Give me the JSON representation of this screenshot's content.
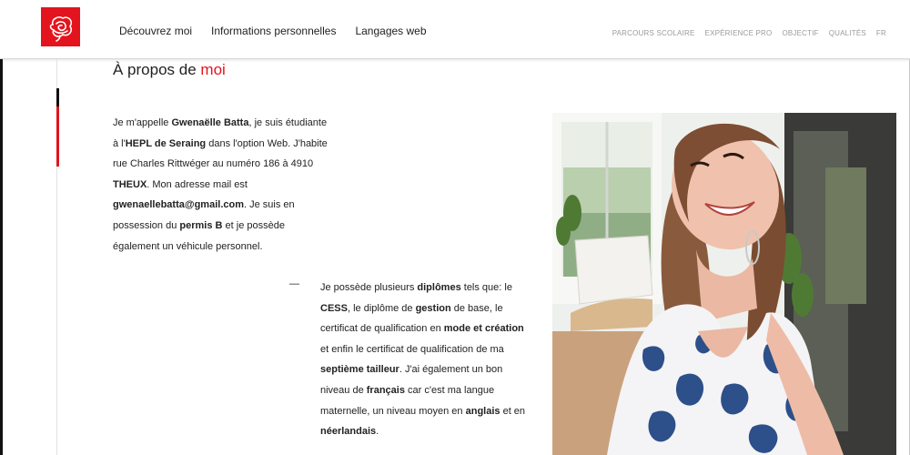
{
  "header": {
    "logo_alt": "Logo",
    "main_nav": [
      "Découvrez moi",
      "Informations personnelles",
      "Langages web"
    ],
    "sub_nav": [
      "PARCOURS SCOLAIRE",
      "EXPÉRIENCE PRO",
      "OBJECTIF",
      "QUALITÉS",
      "FR"
    ]
  },
  "about": {
    "title_prefix": "À propos de ",
    "title_accent": "moi",
    "intro": [
      {
        "t": "Je m'appelle ",
        "b": false
      },
      {
        "t": "Gwenaëlle Batta",
        "b": true
      },
      {
        "t": ", je suis étudiante à l'",
        "b": false
      },
      {
        "t": "HEPL de Seraing",
        "b": true
      },
      {
        "t": " dans l'option Web. J'habite rue Charles Rittwéger au numéro 186 à 4910 ",
        "b": false
      },
      {
        "t": "THEUX",
        "b": true
      },
      {
        "t": ". Mon adresse mail est ",
        "b": false
      },
      {
        "t": "gwenaellebatta@gmail.com",
        "b": true
      },
      {
        "t": ". Je suis en possession du ",
        "b": false
      },
      {
        "t": "permis B",
        "b": true
      },
      {
        "t": " et je possède également un véhicule personnel.",
        "b": false
      }
    ],
    "dash": "—",
    "skills": [
      {
        "t": "Je possède plusieurs ",
        "b": false
      },
      {
        "t": "diplômes",
        "b": true
      },
      {
        "t": " tels que: le ",
        "b": false
      },
      {
        "t": "CESS",
        "b": true
      },
      {
        "t": ", le diplôme de ",
        "b": false
      },
      {
        "t": "gestion",
        "b": true
      },
      {
        "t": " de base, le certificat de qualification en ",
        "b": false
      },
      {
        "t": "mode et création",
        "b": true
      },
      {
        "t": " et enfin le certificat de qualification de ma ",
        "b": false
      },
      {
        "t": "septième tailleur",
        "b": true
      },
      {
        "t": ". J'ai également un bon niveau de ",
        "b": false
      },
      {
        "t": "français",
        "b": true
      },
      {
        "t": " car c'est ma langue maternelle, un niveau moyen en ",
        "b": false
      },
      {
        "t": "anglais",
        "b": true
      },
      {
        "t": " et en ",
        "b": false
      },
      {
        "t": "néerlandais",
        "b": true
      },
      {
        "t": ".",
        "b": false
      }
    ]
  },
  "photo": {
    "icon": "portrait-photo"
  },
  "colors": {
    "accent": "#e3141d",
    "text": "#222222",
    "subnav": "#9a9a9a"
  }
}
